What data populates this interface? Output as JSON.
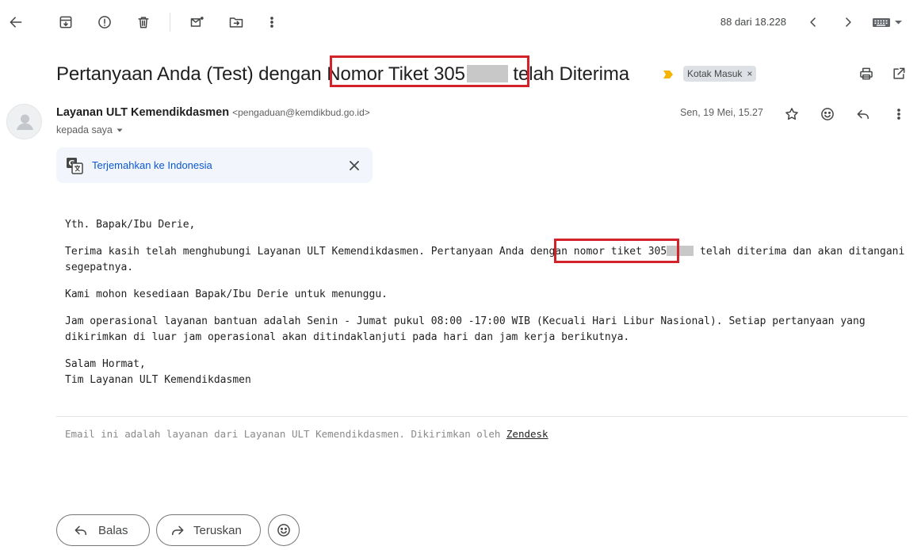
{
  "toolbar": {
    "count": "88 dari 18.228"
  },
  "email": {
    "subject_before": "Pertanyaan Anda (Test) dengan ",
    "subject_ticket": "Nomor Tiket 305",
    "subject_after": " telah Diterima",
    "label": "Kotak Masuk",
    "label_remove": "×",
    "sender_name": "Layanan ULT Kemendikdasmen",
    "sender_email": "<pengaduan@kemdikbud.go.id>",
    "to": "kepada saya",
    "date": "Sen, 19 Mei, 15.27",
    "translate_label": "Terjemahkan ke Indonesia",
    "body": {
      "greeting": "Yth. Bapak/Ibu Derie,",
      "p1_before": "Terima kasih telah menghubungi Layanan ULT Kemendikdasmen. Pertanyaan Anda dengan ",
      "p1_ticket": "nomor tiket 305",
      "p1_after": " telah diterima dan akan ditangani segepatnya.",
      "p2": "Kami mohon kesediaan Bapak/Ibu Derie untuk menunggu.",
      "p3": "Jam operasional layanan bantuan adalah Senin - Jumat pukul 08:00 -17:00 WIB (Kecuali Hari Libur Nasional). Setiap pertanyaan yang dikirimkan di luar jam operasional akan ditindaklanjuti pada hari dan jam kerja berikutnya.",
      "closing_1": "Salam Hormat,",
      "closing_2": "Tim Layanan ULT Kemendikdasmen"
    },
    "footer_text": "Email ini adalah layanan dari Layanan ULT Kemendikdasmen. Dikirimkan oleh ",
    "footer_link": "Zendesk"
  },
  "actions": {
    "reply": "Balas",
    "forward": "Teruskan"
  },
  "colors": {
    "highlight_box": "#d3222a",
    "link": "#0b57d0",
    "label_chip": "#dde1e6",
    "important_marker": "#f4b400"
  }
}
